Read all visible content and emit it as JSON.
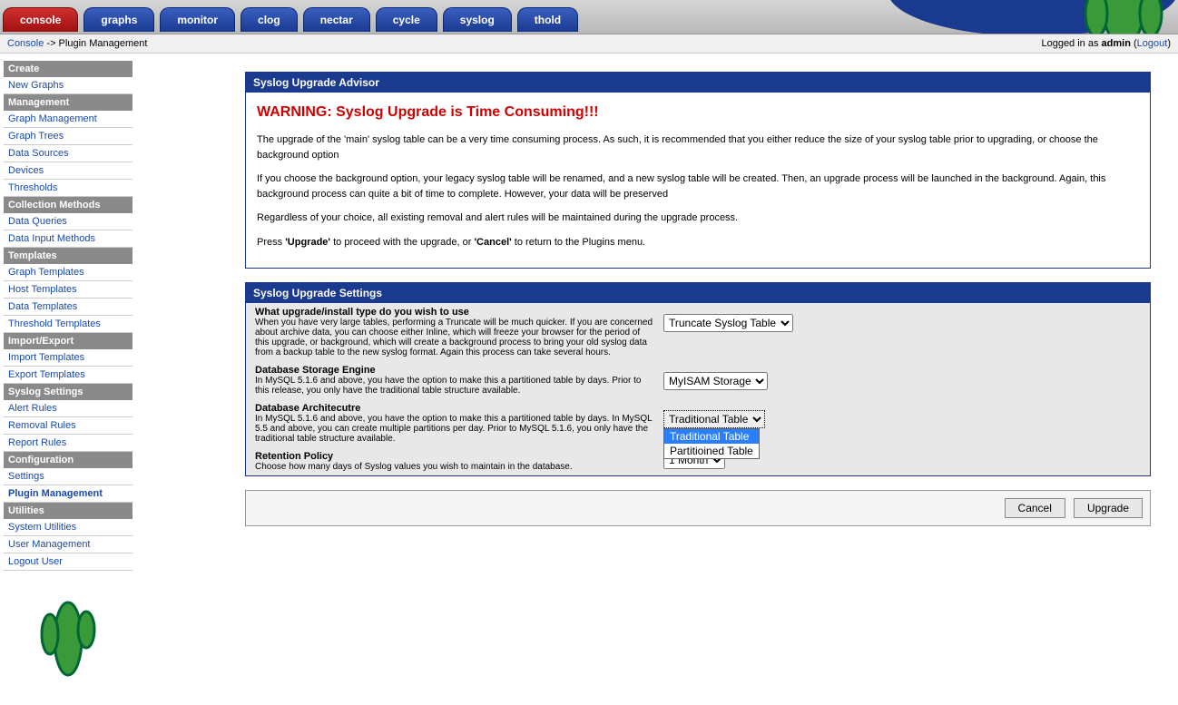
{
  "tabs": [
    "console",
    "graphs",
    "monitor",
    "clog",
    "nectar",
    "cycle",
    "syslog",
    "thold"
  ],
  "active_tab": 0,
  "breadcrumb": {
    "link": "Console",
    "rest": " -> Plugin Management"
  },
  "login": {
    "prefix": "Logged in as ",
    "user": "admin",
    "logout": "Logout"
  },
  "sidebar": [
    {
      "type": "header",
      "label": "Create"
    },
    {
      "type": "link",
      "label": "New Graphs"
    },
    {
      "type": "header",
      "label": "Management"
    },
    {
      "type": "link",
      "label": "Graph Management"
    },
    {
      "type": "link",
      "label": "Graph Trees"
    },
    {
      "type": "link",
      "label": "Data Sources"
    },
    {
      "type": "link",
      "label": "Devices"
    },
    {
      "type": "link",
      "label": "Thresholds"
    },
    {
      "type": "header",
      "label": "Collection Methods"
    },
    {
      "type": "link",
      "label": "Data Queries"
    },
    {
      "type": "link",
      "label": "Data Input Methods"
    },
    {
      "type": "header",
      "label": "Templates"
    },
    {
      "type": "link",
      "label": "Graph Templates"
    },
    {
      "type": "link",
      "label": "Host Templates"
    },
    {
      "type": "link",
      "label": "Data Templates"
    },
    {
      "type": "link",
      "label": "Threshold Templates"
    },
    {
      "type": "header",
      "label": "Import/Export"
    },
    {
      "type": "link",
      "label": "Import Templates"
    },
    {
      "type": "link",
      "label": "Export Templates"
    },
    {
      "type": "header",
      "label": "Syslog Settings"
    },
    {
      "type": "link",
      "label": "Alert Rules"
    },
    {
      "type": "link",
      "label": "Removal Rules"
    },
    {
      "type": "link",
      "label": "Report Rules"
    },
    {
      "type": "header",
      "label": "Configuration"
    },
    {
      "type": "link",
      "label": "Settings"
    },
    {
      "type": "link",
      "label": "Plugin Management",
      "current": true
    },
    {
      "type": "header",
      "label": "Utilities"
    },
    {
      "type": "link",
      "label": "System Utilities"
    },
    {
      "type": "link",
      "label": "User Management"
    },
    {
      "type": "link",
      "label": "Logout User"
    }
  ],
  "advisor": {
    "header": "Syslog Upgrade Advisor",
    "warning": "WARNING: Syslog Upgrade is Time Consuming!!!",
    "p1": "The upgrade of the 'main' syslog table can be a very time consuming process. As such, it is recommended that you either reduce the size of your syslog table prior to upgrading, or choose the background option",
    "p2": "If you choose the background option, your legacy syslog table will be renamed, and a new syslog table will be created. Then, an upgrade process will be launched in the background. Again, this background process can quite a bit of time to complete. However, your data will be preserved",
    "p3": "Regardless of your choice, all existing removal and alert rules will be maintained during the upgrade process.",
    "p4_pre": "Press ",
    "p4_b1": "'Upgrade'",
    "p4_mid": " to proceed with the upgrade, or ",
    "p4_b2": "'Cancel'",
    "p4_post": " to return to the Plugins menu."
  },
  "settings": {
    "header": "Syslog Upgrade Settings",
    "rows": [
      {
        "title": "What upgrade/install type do you wish to use",
        "desc": "When you have very large tables, performing a Truncate will be much quicker. If you are concerned about archive data, you can choose either Inline, which will freeze your browser for the period of this upgrade, or background, which will create a background process to bring your old syslog data from a backup table to the new syslog format. Again this process can take several hours.",
        "value": "Truncate Syslog Table"
      },
      {
        "title": "Database Storage Engine",
        "desc": "In MySQL 5.1.6 and above, you have the option to make this a partitioned table by days. Prior to this release, you only have the traditional table structure available.",
        "value": "MyISAM Storage"
      },
      {
        "title": "Database Architecutre",
        "desc": "In MySQL 5.1.6 and above, you have the option to make this a partitioned table by days. In MySQL 5.5 and above, you can create multiple partitions per day. Prior to MySQL 5.1.6, you only have the traditional table structure available.",
        "value": "Traditional Table",
        "options": [
          "Traditional Table",
          "Partitioined Table"
        ]
      },
      {
        "title": "Retention Policy",
        "desc": "Choose how many days of Syslog values you wish to maintain in the database.",
        "value": "1 Month"
      }
    ]
  },
  "buttons": {
    "cancel": "Cancel",
    "upgrade": "Upgrade"
  }
}
